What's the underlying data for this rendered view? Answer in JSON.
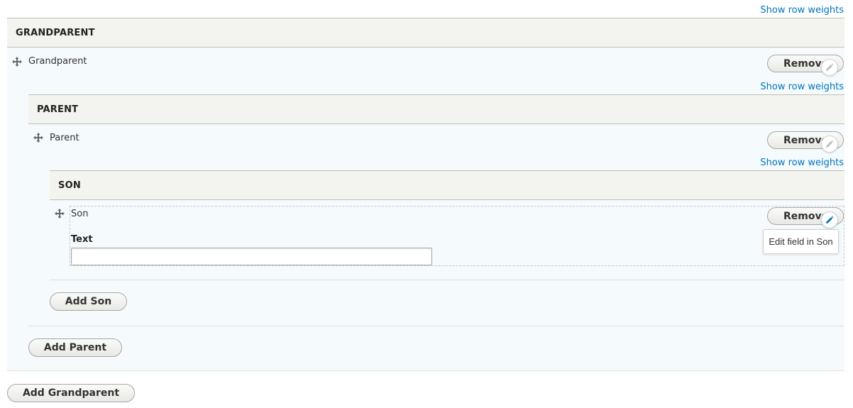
{
  "show_row_weights": "Show row weights",
  "grandparent": {
    "header": "GRANDPARENT",
    "item_label": "Grandparent",
    "remove_label": "Remove",
    "add_label": "Add Grandparent"
  },
  "parent": {
    "header": "PARENT",
    "item_label": "Parent",
    "remove_label": "Remove",
    "add_label": "Add Parent"
  },
  "son": {
    "header": "SON",
    "item_label": "Son",
    "remove_label": "Remove",
    "add_label": "Add Son",
    "field_label": "Text",
    "field_value": "",
    "tooltip": "Edit field in Son"
  },
  "colors": {
    "link": "#0074bd",
    "header_bg": "#f3f3ef",
    "row_bg": "#f5fafd",
    "active_pencil": "#0074bd"
  },
  "icons": {
    "drag": "drag-handle-icon",
    "edit": "pencil-icon"
  }
}
